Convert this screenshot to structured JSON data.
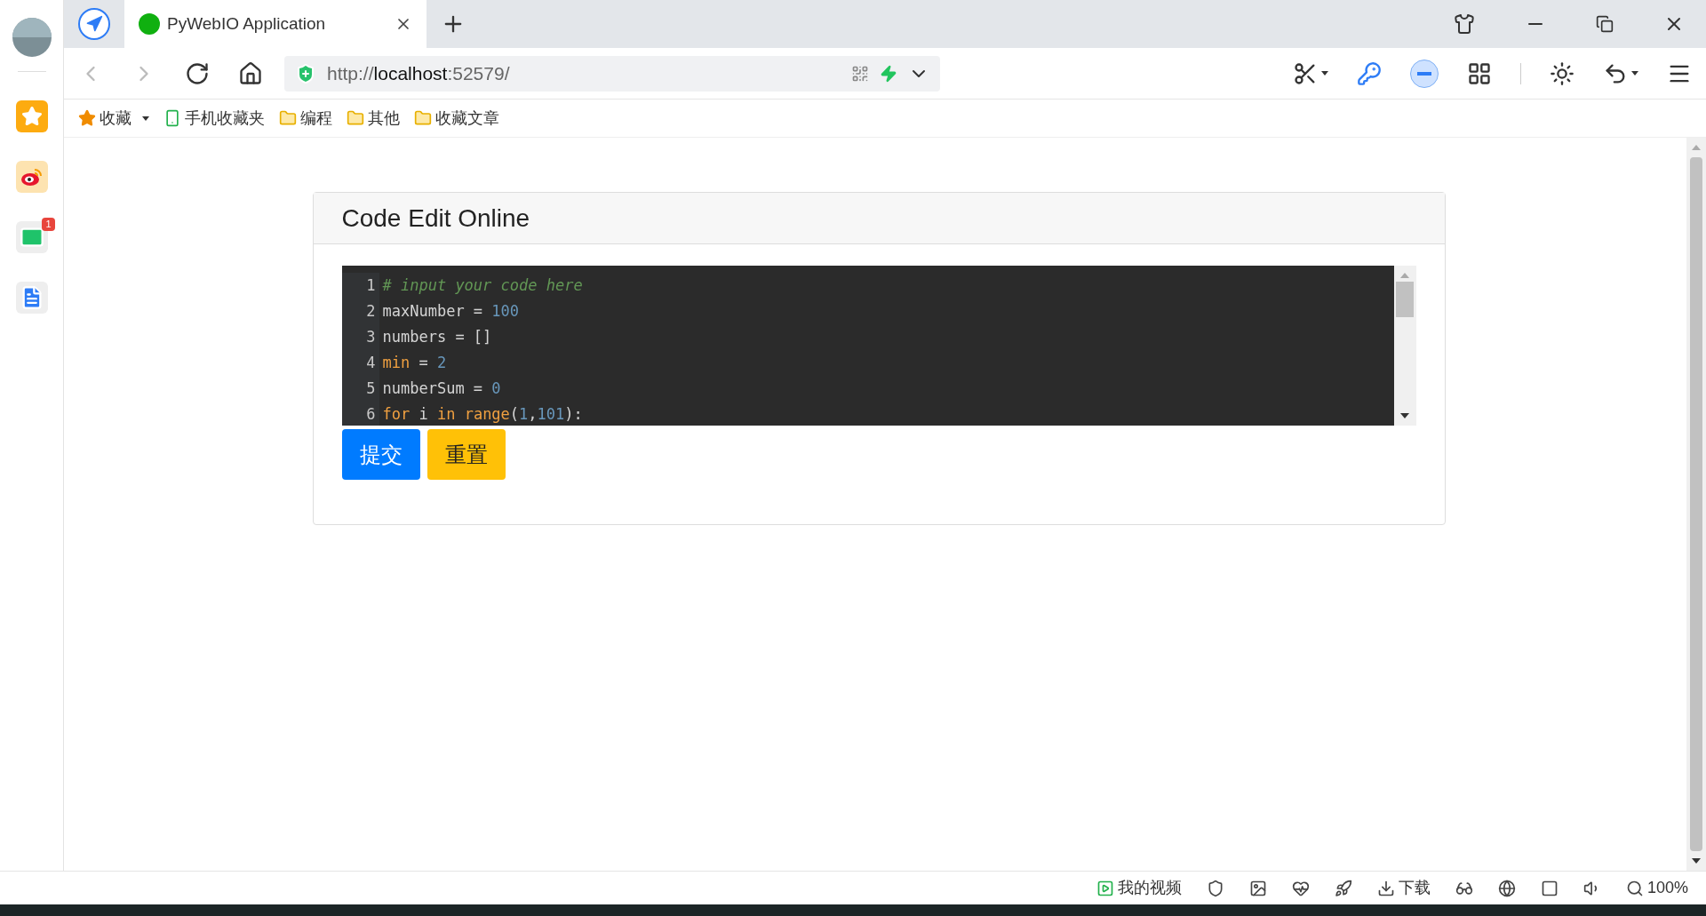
{
  "tabs": [
    {
      "title": "PyWebIO Application",
      "selected": true
    }
  ],
  "address_bar": {
    "scheme": "http://",
    "host": "localhost",
    "rest": ":52579/"
  },
  "bookmarks": [
    {
      "kind": "star",
      "label": "收藏"
    },
    {
      "kind": "phone",
      "label": "手机收藏夹"
    },
    {
      "kind": "folder",
      "label": "编程"
    },
    {
      "kind": "folder",
      "label": "其他"
    },
    {
      "kind": "folder",
      "label": "收藏文章"
    }
  ],
  "sidebar": {
    "apps": [
      {
        "kind": "favorites"
      },
      {
        "kind": "weibo"
      },
      {
        "kind": "mail",
        "badge": "1"
      },
      {
        "kind": "notes"
      }
    ]
  },
  "card": {
    "title": "Code Edit Online",
    "editor": {
      "lines": [
        {
          "number": "1",
          "tokens": [
            {
              "kind": "comment",
              "text": "# input your code here"
            }
          ]
        },
        {
          "number": "2",
          "tokens": [
            {
              "kind": "plain",
              "text": "maxNumber = "
            },
            {
              "kind": "number",
              "text": "100"
            }
          ]
        },
        {
          "number": "3",
          "tokens": [
            {
              "kind": "plain",
              "text": "numbers = []"
            }
          ]
        },
        {
          "number": "4",
          "tokens": [
            {
              "kind": "keyword",
              "text": "min"
            },
            {
              "kind": "plain",
              "text": " = "
            },
            {
              "kind": "number",
              "text": "2"
            }
          ]
        },
        {
          "number": "5",
          "tokens": [
            {
              "kind": "plain",
              "text": "numberSum = "
            },
            {
              "kind": "number",
              "text": "0"
            }
          ]
        },
        {
          "number": "6",
          "tokens": [
            {
              "kind": "keyword",
              "text": "for"
            },
            {
              "kind": "plain",
              "text": " i "
            },
            {
              "kind": "keyword",
              "text": "in"
            },
            {
              "kind": "keyword",
              "text": " range"
            },
            {
              "kind": "plain",
              "text": "("
            },
            {
              "kind": "number",
              "text": "1"
            },
            {
              "kind": "plain",
              "text": ","
            },
            {
              "kind": "number",
              "text": "101"
            },
            {
              "kind": "plain",
              "text": "):"
            }
          ]
        }
      ]
    },
    "buttons": [
      {
        "kind": "primary",
        "label": "提交"
      },
      {
        "kind": "warning",
        "label": "重置"
      }
    ]
  },
  "status_bar": [
    {
      "kind": "video",
      "label": "我的视频"
    },
    {
      "kind": "shield"
    },
    {
      "kind": "image"
    },
    {
      "kind": "health"
    },
    {
      "kind": "rocket"
    },
    {
      "kind": "download",
      "label": "下载"
    },
    {
      "kind": "glasses"
    },
    {
      "kind": "browser"
    },
    {
      "kind": "window"
    },
    {
      "kind": "volume"
    },
    {
      "kind": "zoom",
      "label": "100%"
    }
  ]
}
